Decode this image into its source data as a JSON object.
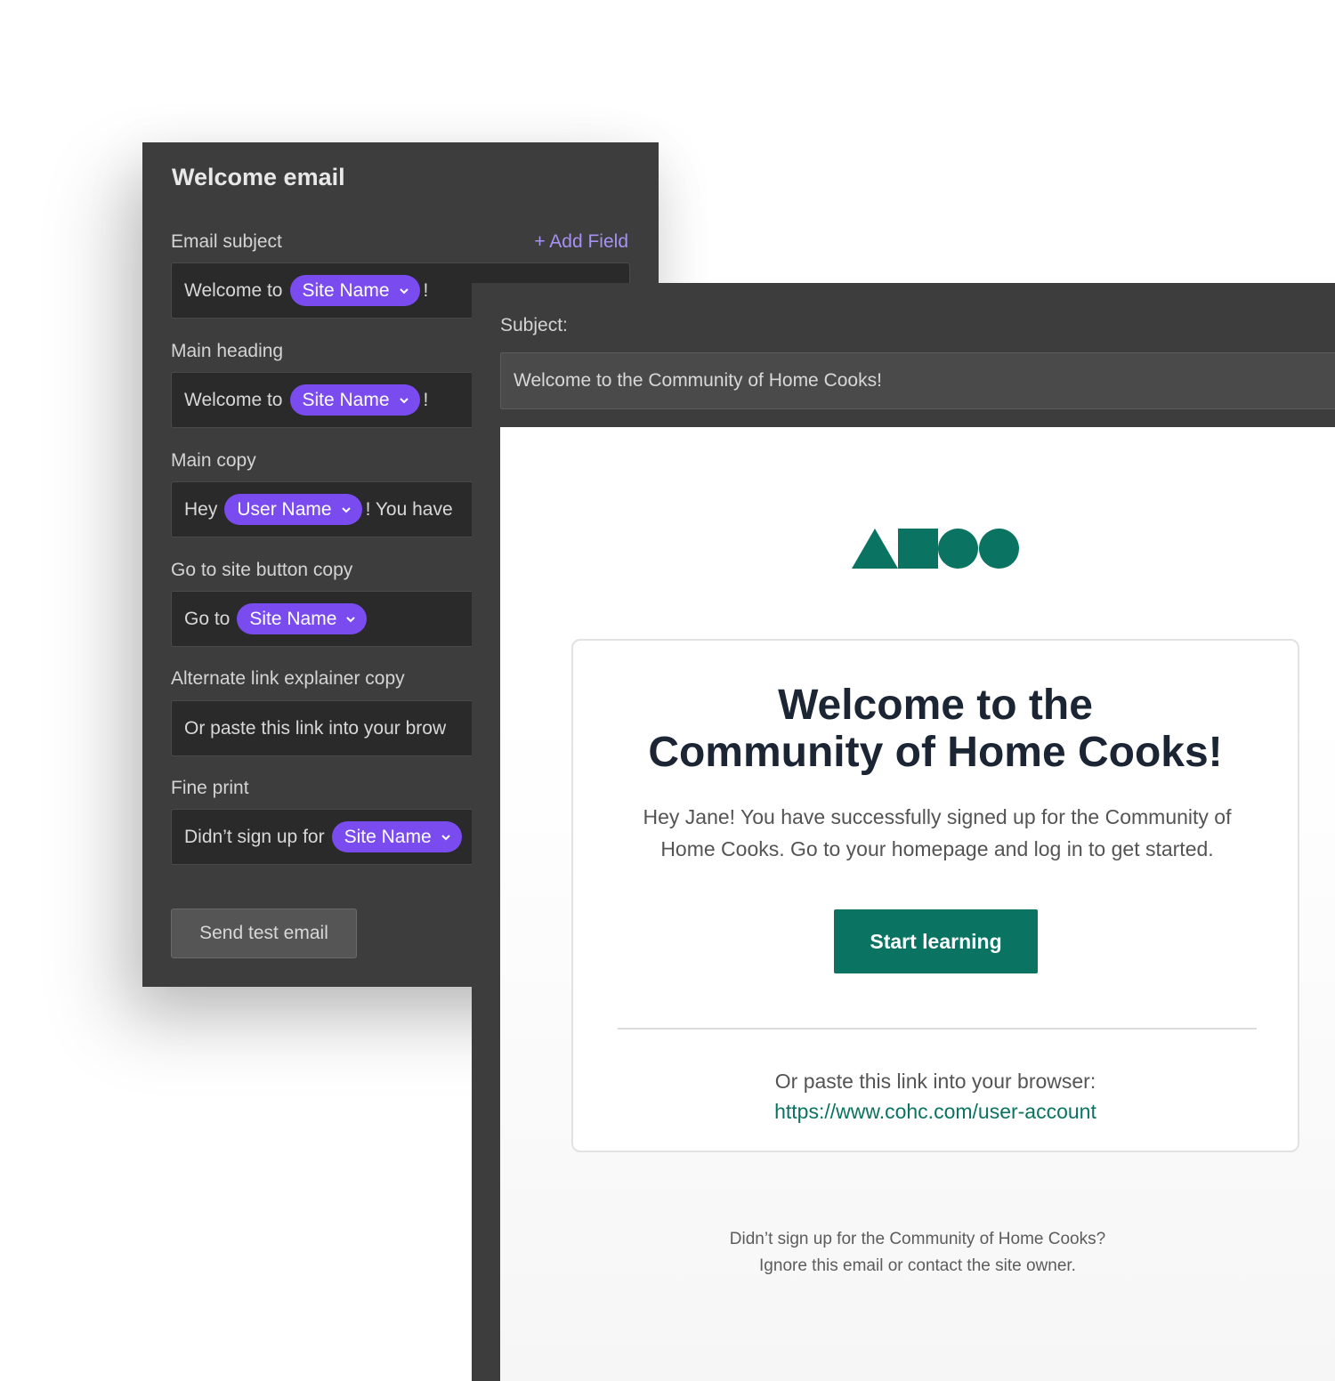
{
  "editor": {
    "title": "Welcome email",
    "add_field": "+ Add Field",
    "fields": [
      {
        "label": "Email subject",
        "prefix": "Welcome to",
        "token": "Site Name",
        "suffix": "!"
      },
      {
        "label": "Main heading",
        "prefix": "Welcome to",
        "token": "Site Name",
        "suffix": "!"
      },
      {
        "label": "Main copy",
        "prefix": "Hey",
        "token": "User Name",
        "suffix": "! You have"
      },
      {
        "label": "Go to site button copy",
        "prefix": "Go to",
        "token": "Site Name",
        "suffix": ""
      },
      {
        "label": "Alternate link explainer copy",
        "text": "Or paste this link into your brow"
      },
      {
        "label": "Fine print",
        "prefix": "Didn’t sign up for",
        "token": "Site Name",
        "suffix": ""
      }
    ],
    "send_button": "Send test email"
  },
  "preview": {
    "subject_label": "Subject:",
    "subject_value": "Welcome to the Community of Home Cooks!",
    "heading_line1": "Welcome to the",
    "heading_line2": "Community of Home Cooks!",
    "copy_line1": "Hey Jane! You have successfully signed up for the Community of",
    "copy_line2": "Home Cooks. Go to your homepage and log in to get started.",
    "cta_label": "Start learning",
    "alt_copy": "Or paste this link into your browser:",
    "alt_link": "https://www.cohc.com/user-account",
    "fine_print_line1": "Didn’t sign up for the Community of Home Cooks?",
    "fine_print_line2": "Ignore this email or contact the site owner."
  },
  "colors": {
    "panel": "#3d3d3d",
    "field": "#2a2a2a",
    "token": "#7a4cf0",
    "link_accent": "#a891f5",
    "brand_green": "#0a7361",
    "heading_text": "#1c2533"
  },
  "icons": [
    "chevron-down-icon",
    "brand-logo-shapes"
  ]
}
